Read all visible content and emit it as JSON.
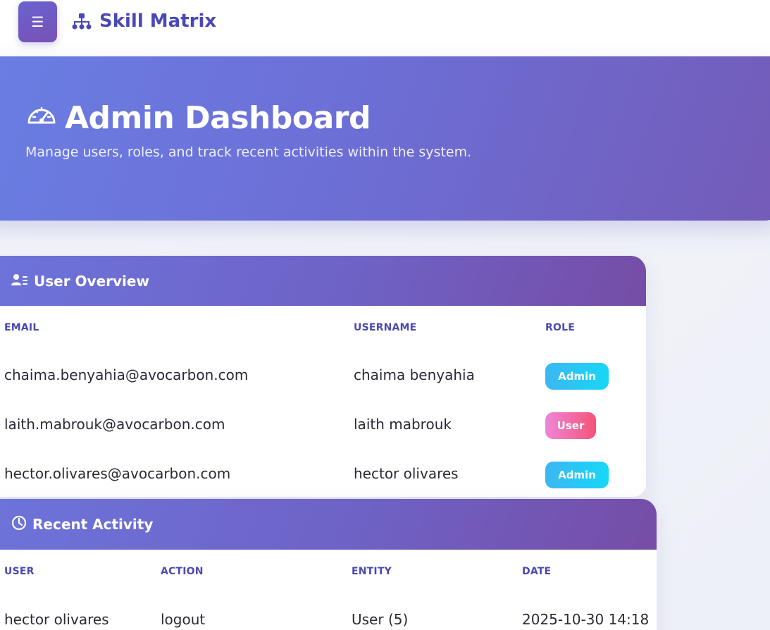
{
  "app": {
    "brand": "Skill Matrix",
    "menu_icon": "☰"
  },
  "hero": {
    "title": "Admin Dashboard",
    "subtitle": "Manage users, roles, and track recent activities within the system."
  },
  "users": {
    "title": "User Overview",
    "columns": [
      "EMAIL",
      "USERNAME",
      "ROLE"
    ],
    "rows": [
      {
        "email": "chaima.benyahia@avocarbon.com",
        "username": "chaima benyahia",
        "role": "Admin"
      },
      {
        "email": "laith.mabrouk@avocarbon.com",
        "username": "laith mabrouk",
        "role": "User"
      },
      {
        "email": "hector.olivares@avocarbon.com",
        "username": "hector olivares",
        "role": "Admin"
      }
    ]
  },
  "activity": {
    "title": "Recent Activity",
    "columns": [
      "USER",
      "ACTION",
      "ENTITY",
      "DATE"
    ],
    "rows": [
      {
        "user": "hector olivares",
        "action": "logout",
        "entity": "User (5)",
        "date": "2025-10-30 14:18"
      }
    ]
  },
  "colors": {
    "accent": "#4a48b6",
    "admin_badge": "#17d7f6",
    "user_badge": "#f45476"
  },
  "icons": {
    "menu": "menu-icon",
    "brand": "sitemap-icon",
    "hero": "gauge-icon",
    "users": "user-list-icon",
    "activity": "clock-icon"
  }
}
